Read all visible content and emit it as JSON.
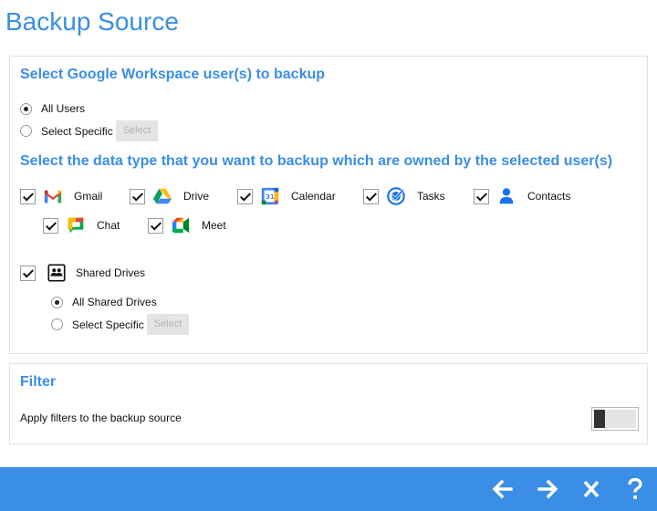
{
  "page": {
    "title": "Backup Source"
  },
  "users_section": {
    "heading": "Select Google Workspace user(s) to backup",
    "options": [
      {
        "label": "All Users",
        "selected": true
      },
      {
        "label": "Select Specific",
        "selected": false,
        "button_label": "Select"
      }
    ]
  },
  "data_type_section": {
    "heading": "Select the data type that you want to backup which are owned by the selected user(s)",
    "items": [
      {
        "label": "Gmail",
        "checked": true,
        "icon": "gmail-icon"
      },
      {
        "label": "Drive",
        "checked": true,
        "icon": "google-drive-icon"
      },
      {
        "label": "Calendar",
        "checked": true,
        "icon": "google-calendar-icon",
        "icon_text": "31"
      },
      {
        "label": "Tasks",
        "checked": true,
        "icon": "google-tasks-icon"
      },
      {
        "label": "Contacts",
        "checked": true,
        "icon": "google-contacts-icon"
      },
      {
        "label": "Chat",
        "checked": true,
        "icon": "google-chat-icon"
      },
      {
        "label": "Meet",
        "checked": true,
        "icon": "google-meet-icon"
      }
    ]
  },
  "shared_drives": {
    "label": "Shared Drives",
    "checked": true,
    "icon": "shared-drives-icon",
    "options": [
      {
        "label": "All Shared Drives",
        "selected": true
      },
      {
        "label": "Select Specific",
        "selected": false,
        "button_label": "Select"
      }
    ]
  },
  "filter_section": {
    "heading": "Filter",
    "toggle_label": "Apply filters to the backup source",
    "toggle_on": false
  },
  "footer": {
    "buttons": [
      "back-arrow-icon",
      "next-arrow-icon",
      "close-icon",
      "help-icon"
    ],
    "background_color": "#3a8ee6"
  }
}
